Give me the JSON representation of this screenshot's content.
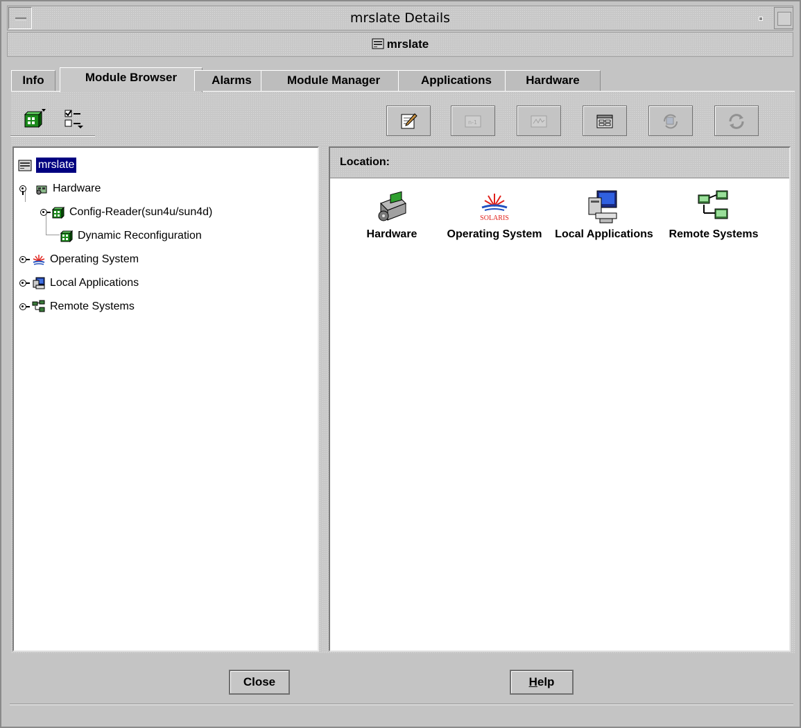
{
  "window": {
    "title": "mrslate Details",
    "host_label": "mrslate"
  },
  "tabs": [
    {
      "label": "Info"
    },
    {
      "label": "Module Browser",
      "active": true
    },
    {
      "label": "Alarms"
    },
    {
      "label": "Module Manager"
    },
    {
      "label": "Applications"
    },
    {
      "label": "Hardware"
    }
  ],
  "toolbar": {
    "left": [
      {
        "icon": "module-view-icon"
      },
      {
        "icon": "checklist-menu-icon"
      }
    ],
    "right": [
      {
        "icon": "edit-note-icon",
        "enabled": true
      },
      {
        "icon": "table-view-icon",
        "enabled": false
      },
      {
        "icon": "graph-icon",
        "enabled": false
      },
      {
        "icon": "property-sheet-icon",
        "enabled": true
      },
      {
        "icon": "refresh-node-icon",
        "enabled": false
      },
      {
        "icon": "refresh-icon",
        "enabled": false
      }
    ]
  },
  "tree": {
    "root": "mrslate",
    "items": [
      {
        "label": "Hardware",
        "icon": "hardware-icon"
      },
      {
        "label": "Config-Reader(sun4u/sun4d)",
        "icon": "module-icon"
      },
      {
        "label": "Dynamic Reconfiguration",
        "icon": "module-icon"
      },
      {
        "label": "Operating System",
        "icon": "solaris-icon"
      },
      {
        "label": "Local Applications",
        "icon": "local-applications-icon"
      },
      {
        "label": "Remote Systems",
        "icon": "remote-systems-icon"
      }
    ]
  },
  "location": {
    "label": "Location:",
    "value": ""
  },
  "grid": [
    {
      "label": "Hardware",
      "icon": "hardware-icon"
    },
    {
      "label": "Operating System",
      "icon": "solaris-logo-icon",
      "logo_text": "SOLARIS"
    },
    {
      "label": "Local Applications",
      "icon": "local-applications-icon"
    },
    {
      "label": "Remote Systems",
      "icon": "remote-systems-icon"
    }
  ],
  "buttons": {
    "close": "Close",
    "help_mnemonic": "H",
    "help_rest": "elp"
  },
  "colors": {
    "selection": "#000080",
    "window_bg": "#c6c6c6"
  }
}
